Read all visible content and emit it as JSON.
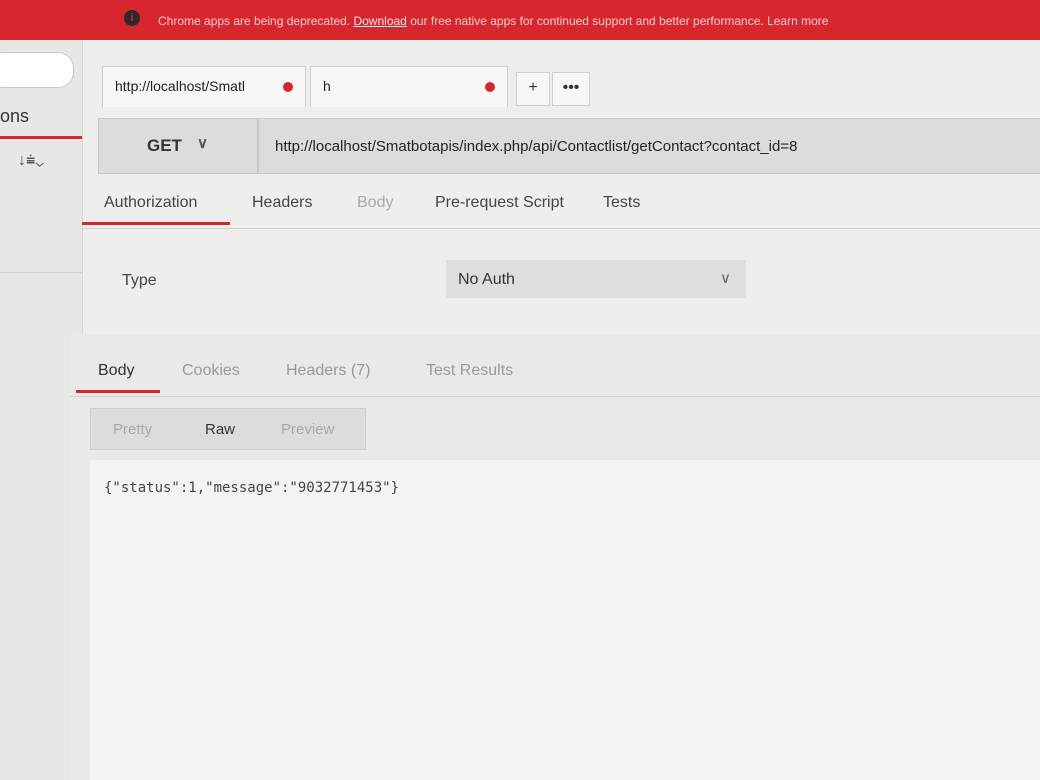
{
  "banner": {
    "text": "Chrome apps are being deprecated.",
    "link": "Download",
    "rest": "our free native apps for continued support and better performance. Learn more"
  },
  "sidebar": {
    "tab_label": "ons"
  },
  "tabs": [
    {
      "title": "http://localhost/Smatl"
    },
    {
      "title": "h"
    }
  ],
  "tab_buttons": {
    "add": "+",
    "more": "•••"
  },
  "request": {
    "method": "GET",
    "url": "http://localhost/Smatbotapis/index.php/api/Contactlist/getContact?contact_id=8"
  },
  "request_tabs": [
    "Authorization",
    "Headers",
    "Body",
    "Pre-request Script",
    "Tests"
  ],
  "auth": {
    "type_label": "Type",
    "type_value": "No Auth"
  },
  "response_tabs": [
    "Body",
    "Cookies",
    "Headers (7)",
    "Test Results"
  ],
  "format_buttons": [
    "Pretty",
    "Raw",
    "Preview"
  ],
  "response_body": "{\"status\":1,\"message\":\"9032771453\"}",
  "colors": {
    "accent": "#d8262f",
    "banner_bg": "#d8262f"
  }
}
